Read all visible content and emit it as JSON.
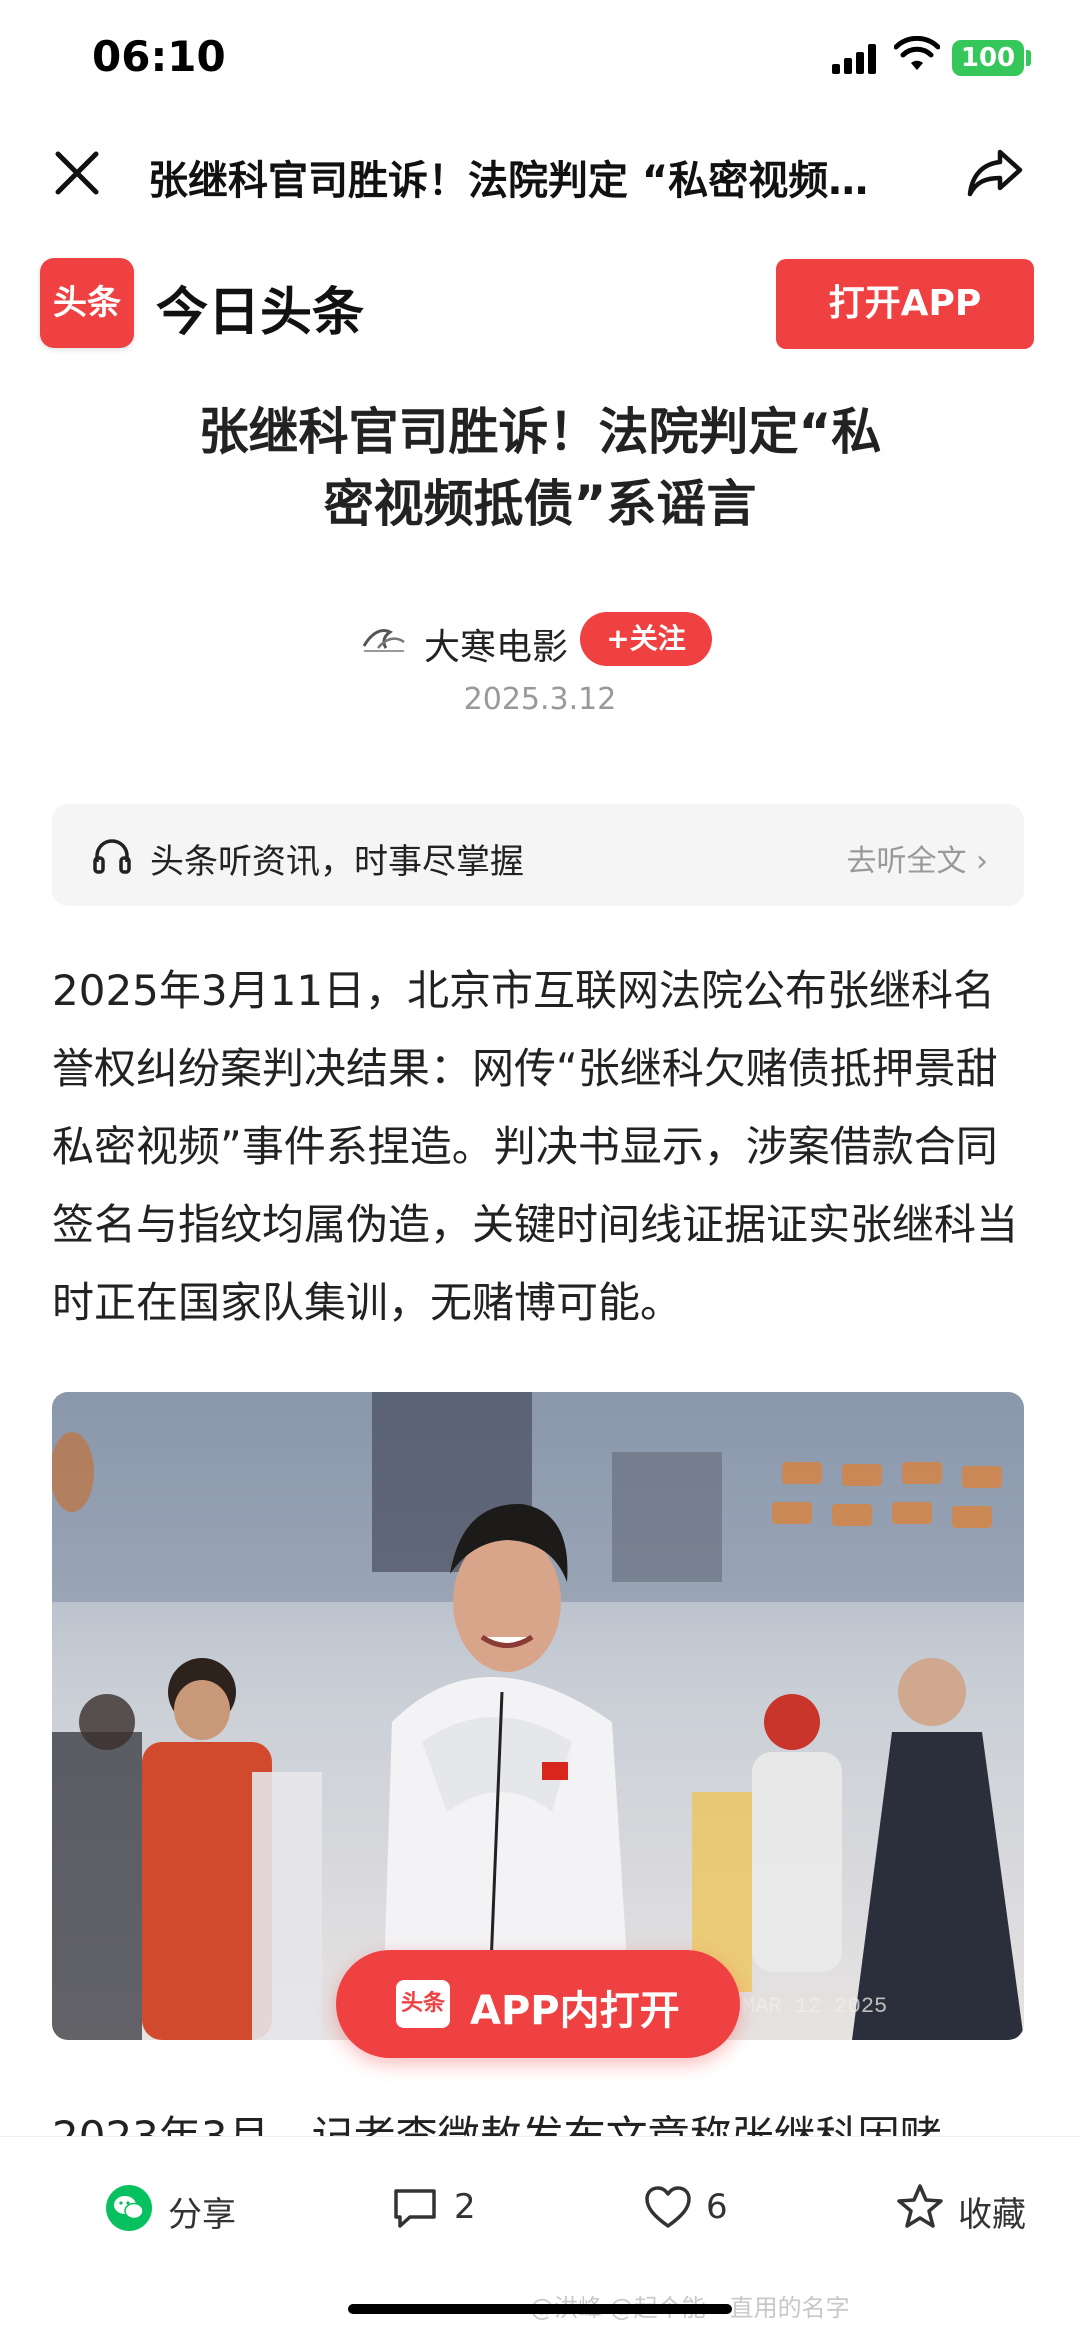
{
  "status_bar": {
    "time": "06:10",
    "battery": "100"
  },
  "nav": {
    "title": "张继科官司胜诉！法院判定 “私密视频…"
  },
  "brand": {
    "logo_text": "头条",
    "name": "今日头条",
    "open_app": "打开APP"
  },
  "article": {
    "headline_line1": "张继科官司胜诉！法院判定“私",
    "headline_line2": "密视频抵债”系谣言",
    "author": "大寒电影",
    "follow": "+关注",
    "date": "2025.3.12",
    "paragraph": "2025年3月11日，北京市互联网法院公布张继科名誉权纠纷案判决结果：网传“张继科欠赌债抵押景甜私密视频”事件系捏造。判决书显示，涉案借款合同签名与指纹均属伪造，关键时间线证据证实张继科当时正在国家队集训，无赌博可能。",
    "next_paragraph_partial": "2023年3月，记者李微敖发布文章称张继科因赌"
  },
  "listen": {
    "text": "头条听资讯，时事尽掌握",
    "more": "去听全文 ›"
  },
  "photo": {
    "stamp": "MAR 12 2025"
  },
  "float_button": {
    "logo_text": "头条",
    "label": "APP内打开"
  },
  "bottom_bar": {
    "share": "分享",
    "comments": "2",
    "likes": "6",
    "favorite": "收藏"
  },
  "watermark": "@洪峰 @起个能一直用的名字"
}
